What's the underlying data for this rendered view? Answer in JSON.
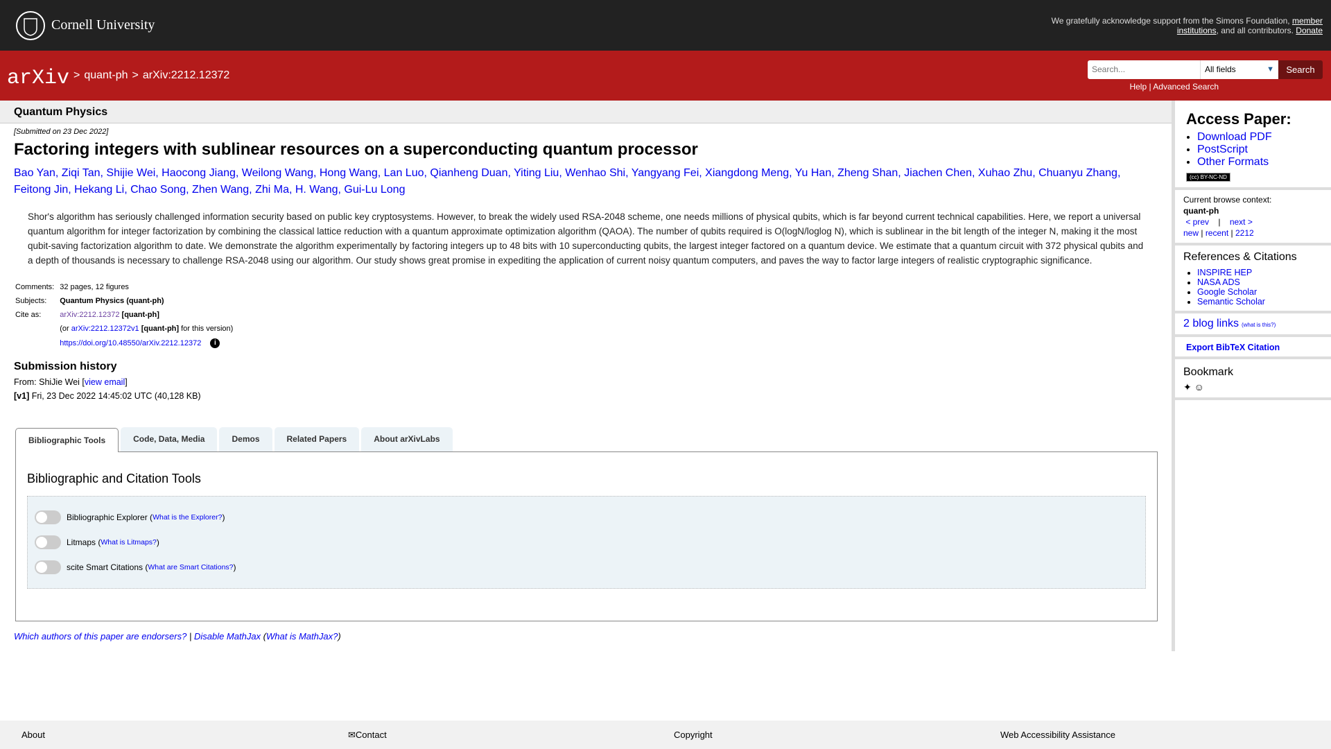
{
  "topbar": {
    "institution": "Cornell University",
    "ack_text": "We gratefully acknowledge support from the Simons Foundation,",
    "ack_link_member": "member institutions",
    "ack_tail": ", and all contributors.",
    "ack_link_donate": "Donate"
  },
  "breadcrumb": {
    "sep": ">",
    "category": "quant-ph",
    "paper_id": "arXiv:2212.12372"
  },
  "search": {
    "placeholder": "Search...",
    "field_selected": "All fields",
    "button_label": "Search",
    "help_label": "Help",
    "divider": "|",
    "advanced_label": "Advanced Search"
  },
  "paper": {
    "subject_header": "Quantum Physics",
    "submitted": "[Submitted on 23 Dec 2022]",
    "title": "Factoring integers with sublinear resources on a superconducting quantum processor",
    "authors": [
      "Bao Yan",
      "Ziqi Tan",
      "Shijie Wei",
      "Haocong Jiang",
      "Weilong Wang",
      "Hong Wang",
      "Lan Luo",
      "Qianheng Duan",
      "Yiting Liu",
      "Wenhao Shi",
      "Yangyang Fei",
      "Xiangdong Meng",
      "Yu Han",
      "Zheng Shan",
      "Jiachen Chen",
      "Xuhao Zhu",
      "Chuanyu Zhang",
      "Feitong Jin",
      "Hekang Li",
      "Chao Song",
      "Zhen Wang",
      "Zhi Ma",
      "H. Wang",
      "Gui-Lu Long"
    ],
    "abstract": "Shor's algorithm has seriously challenged information security based on public key cryptosystems. However, to break the widely used RSA-2048 scheme, one needs millions of physical qubits, which is far beyond current technical capabilities. Here, we report a universal quantum algorithm for integer factorization by combining the classical lattice reduction with a quantum approximate optimization algorithm (QAOA). The number of qubits required is O(logN/loglog N), which is sublinear in the bit length of the integer N, making it the most qubit-saving factorization algorithm to date. We demonstrate the algorithm experimentally by factoring integers up to 48 bits with 10 superconducting qubits, the largest integer factored on a quantum device. We estimate that a quantum circuit with 372 physical qubits and a depth of thousands is necessary to challenge RSA-2048 using our algorithm. Our study shows great promise in expediting the application of current noisy quantum computers, and paves the way to factor large integers of realistic cryptographic significance.",
    "meta": {
      "comments_label": "Comments:",
      "comments": "32 pages, 12 figures",
      "subjects_label": "Subjects:",
      "subjects": "Quantum Physics (quant-ph)",
      "cite_label": "Cite as:",
      "cite_id": "arXiv:2212.12372",
      "cite_cat": "[quant-ph]",
      "version_prefix": "(or",
      "version_id": "arXiv:2212.12372v1",
      "version_cat": "[quant-ph]",
      "version_suffix": "for this version)",
      "doi": "https://doi.org/10.48550/arXiv.2212.12372"
    },
    "history": {
      "heading": "Submission history",
      "from_label": "From: ShiJie Wei",
      "view_email": "view email",
      "v1_label": "[v1]",
      "v1_text": "Fri, 23 Dec 2022 14:45:02 UTC (40,128 KB)"
    }
  },
  "tabs": [
    {
      "label": "Bibliographic Tools",
      "active": true
    },
    {
      "label": "Code, Data, Media",
      "active": false
    },
    {
      "label": "Demos",
      "active": false
    },
    {
      "label": "Related Papers",
      "active": false
    },
    {
      "label": "About arXivLabs",
      "active": false
    }
  ],
  "tools": {
    "heading": "Bibliographic and Citation Tools",
    "toggles": [
      {
        "label": "Bibliographic Explorer",
        "help": "What is the Explorer?",
        "on": false
      },
      {
        "label": "Litmaps",
        "help": "What is Litmaps?",
        "on": false
      },
      {
        "label": "scite Smart Citations",
        "help": "What are Smart Citations?",
        "on": false
      }
    ]
  },
  "endorsers": {
    "link": "Which authors of this paper are endorsers?",
    "sep": "|",
    "mathjax": "Disable MathJax",
    "mathjax_help": "What is MathJax?"
  },
  "sidebar": {
    "access_heading": "Access Paper:",
    "access_links": [
      "Download PDF",
      "PostScript",
      "Other Formats"
    ],
    "license": "BY-NC-ND",
    "browse_label": "Current browse context:",
    "browse_context": "quant-ph",
    "prev": "< prev",
    "next": "next >",
    "new": "new",
    "recent": "recent",
    "month": "2212",
    "refs_heading": "References & Citations",
    "refs": [
      "INSPIRE HEP",
      "NASA ADS",
      "Google Scholar",
      "Semantic Scholar"
    ],
    "blog_links": "2 blog links",
    "blog_help": "(what is this?)",
    "bibtex": "Export BibTeX Citation",
    "bookmark_heading": "Bookmark"
  },
  "footer": {
    "about": "About",
    "contact": "Contact",
    "copyright": "Copyright",
    "accessibility": "Web Accessibility Assistance"
  }
}
